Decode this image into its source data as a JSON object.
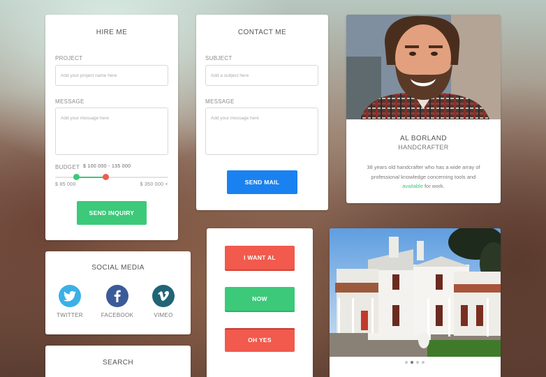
{
  "hire": {
    "title": "HIRE ME",
    "project_label": "PROJECT",
    "project_placeholder": "Add your project name here",
    "message_label": "MESSAGE",
    "message_placeholder": "Add your message here",
    "budget_label": "BUDGET",
    "budget_range": "$ 100 000 - 135 000",
    "budget_min": "$ 85 000",
    "budget_max": "$ 350 000 +",
    "send_label": "SEND INQUIRY",
    "colors": {
      "track_active": "#3cc97a",
      "handle_low": "#3cc97a",
      "handle_high": "#f15a4d"
    }
  },
  "contact": {
    "title": "CONTACT ME",
    "subject_label": "SUBJECT",
    "subject_placeholder": "Add a subject here",
    "message_label": "MESSAGE",
    "message_placeholder": "Add your message here",
    "send_label": "SEND MAIL"
  },
  "profile": {
    "name": "AL BORLAND",
    "role": "HANDCRAFTER",
    "bio_before": "38 years old handcrafter who has a wide array of professional knowledge concerning tools and ",
    "bio_link": "available",
    "bio_after": " for work."
  },
  "social": {
    "title": "SOCIAL MEDIA",
    "items": [
      {
        "label": "TWITTER",
        "icon": "twitter-icon",
        "color": "#3ab0e8"
      },
      {
        "label": "FACEBOOK",
        "icon": "facebook-icon",
        "color": "#3b5a99"
      },
      {
        "label": "VIMEO",
        "icon": "vimeo-icon",
        "color": "#216476"
      }
    ]
  },
  "buttons": {
    "want": "I WANT AL",
    "now": "NOW",
    "ohyes": "OH YES"
  },
  "search": {
    "title": "SEARCH"
  },
  "gallery": {
    "slide_count": 4,
    "active_slide": 2
  }
}
